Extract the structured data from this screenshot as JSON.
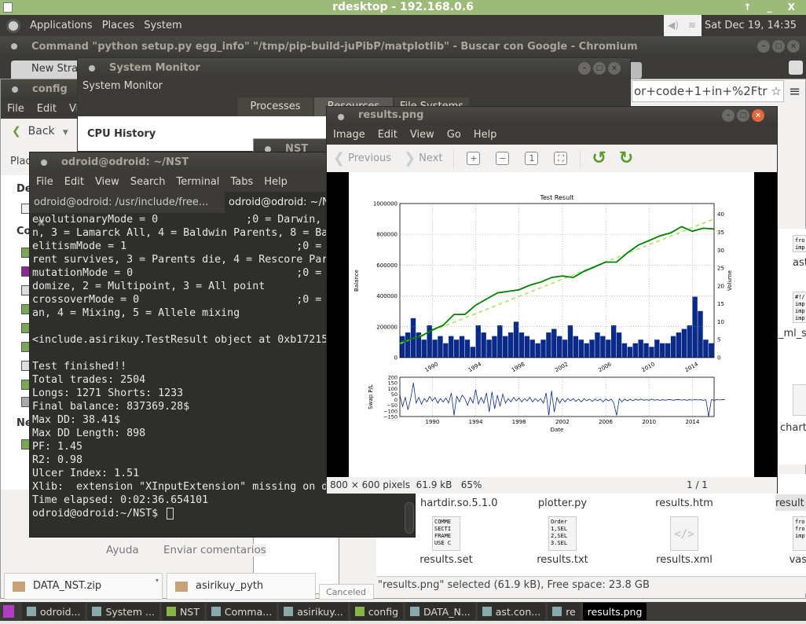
{
  "rdesktop": {
    "title": "rdesktop - 192.168.0.6",
    "controls": "↑ _ X"
  },
  "panel": {
    "menus": [
      "Applications",
      "Places",
      "System"
    ],
    "clock": "Sat Dec 19, 14:35",
    "tray_icons": [
      "volume-icon",
      "wifi-icon"
    ]
  },
  "chromium": {
    "title": "Command \"python setup.py egg_info\" \"/tmp/pip-build-juPibP/matplotlib\" - Buscar con Google - Chromium",
    "tab": "New Strat",
    "omnibox": "or+code+1+in+%2Ftr",
    "footer_links": [
      "Ayuda",
      "Enviar comentarios"
    ],
    "downloads": [
      {
        "name": "DATA_NST.zip"
      },
      {
        "name": "asirikuy_pyth"
      }
    ],
    "canceled": "Canceled"
  },
  "sysmon": {
    "title": "System Monitor",
    "header": "System Monitor",
    "tabs": [
      "Processes",
      "Resources",
      "File Systems"
    ],
    "section": "CPU History"
  },
  "config": {
    "title": "config",
    "menus": [
      "File",
      "Edit",
      "Vi"
    ],
    "back": "Back",
    "places": "Plac",
    "sidebar_headers": [
      "De",
      "Co",
      "Ne"
    ]
  },
  "nst": {
    "title": "NST"
  },
  "terminal": {
    "title": "odroid@odroid: ~/NST",
    "menus": [
      "File",
      "Edit",
      "View",
      "Search",
      "Terminal",
      "Tabs",
      "Help"
    ],
    "tabs": [
      "odroid@odroid: /usr/include/free...",
      "odroid@odroid: ~/NST"
    ],
    "lines": [
      "evolutionaryMode = 0              ;0 = Darwin, 1",
      "n, 3 = Lamarck All, 4 = Baldwin Parents, 8 = Ba",
      "elitismMode = 1                           ;0 = Ur",
      "rent survives, 3 = Parents die, 4 = Rescore Par",
      "mutationMode = 0                          ;0 = Si",
      "domize, 2 = Multipoint, 3 = All point",
      "crossoverMode = 0                         ;0 = Si",
      "an, 4 = Mixing, 5 = Allele mixing",
      "",
      "<include.asirikuy.TestResult object at 0xb17215",
      "",
      "Test finished!!",
      "Total trades: 2504",
      "Longs: 1271 Shorts: 1233",
      "Final balance: 837369.28$",
      "Max DD: 38.41$",
      "Max DD Length: 898",
      "PF: 1.45",
      "R2: 0.98",
      "Ulcer Index: 1.51",
      "Xlib:  extension \"XInputExtension\" missing on d",
      "Time elapsed: 0:02:36.654101",
      "odroid@odroid:~/NST$ "
    ]
  },
  "viewer": {
    "title": "results.png",
    "menus": [
      "Image",
      "Edit",
      "View",
      "Go",
      "Help"
    ],
    "toolbar": {
      "previous": "Previous",
      "next": "Next"
    },
    "status": {
      "dimensions": "800 × 600 pixels",
      "size": "61.9 kB",
      "zoom": "65%",
      "page": "1 / 1"
    }
  },
  "files": {
    "items": [
      {
        "name": "hartdir.so.5.1.0",
        "thumb": ""
      },
      {
        "name": "plotter.py",
        "thumb": ""
      },
      {
        "name": "results.htm",
        "thumb": ""
      },
      {
        "name": "result",
        "thumb": ""
      },
      {
        "name": "results.set",
        "thumb": "COMME\nSECTI\nFRAME\nUSE C"
      },
      {
        "name": "results.txt",
        "thumb": "Order\n1,SEL\n2,SEL\n3.SEL"
      },
      {
        "name": "results.xml",
        "thumb": "</>"
      },
      {
        "name": "vas",
        "thumb": "fro\nfro\nimp"
      }
    ],
    "right_items": [
      {
        "name": "ast",
        "thumb": "fro\nimp"
      },
      {
        "name": "_ml_st",
        "thumb": "#!/\nimp\nimp\nimp"
      },
      {
        "name": "chart",
        "thumb": ""
      }
    ],
    "status": "\"results.png\" selected (61.9 kB), Free space: 23.8 GB"
  },
  "taskbar": {
    "items": [
      "odroid...",
      "System ...",
      "NST",
      "Comma...",
      "asirikuy...",
      "config",
      "DATA_N...",
      "ast.con...",
      "re",
      "results.png"
    ]
  },
  "chart_data": [
    {
      "type": "line",
      "title": "Test Result",
      "xlabel": "",
      "ylabel": "Balance",
      "y2label": "Volume",
      "xlim": [
        1987,
        2016
      ],
      "ylim": [
        0,
        1000000
      ],
      "y2lim": [
        0,
        43
      ],
      "grid": true,
      "xticks": [
        "1990",
        "1994",
        "1998",
        "2002",
        "2006",
        "2010",
        "2014"
      ],
      "yticks": [
        "0",
        "200000",
        "400000",
        "600000",
        "800000",
        "1000000"
      ],
      "y2ticks": [
        "0",
        "5",
        "10",
        "15",
        "20",
        "25",
        "30",
        "35",
        "40"
      ],
      "balance": {
        "x": [
          1987,
          1988,
          1989,
          1990,
          1991,
          1992,
          1993,
          1994,
          1995,
          1996,
          1997,
          1998,
          1999,
          2000,
          2001,
          2002,
          2003,
          2004,
          2005,
          2006,
          2007,
          2008,
          2009,
          2010,
          2011,
          2012,
          2013,
          2014,
          2015,
          2016
        ],
        "y": [
          100000,
          120000,
          140000,
          180000,
          210000,
          280000,
          280000,
          340000,
          380000,
          420000,
          430000,
          440000,
          470000,
          490000,
          520000,
          530000,
          520000,
          560000,
          590000,
          620000,
          620000,
          680000,
          730000,
          760000,
          790000,
          810000,
          850000,
          820000,
          840000,
          835000
        ],
        "color": "#008000"
      },
      "trend": {
        "x": [
          1987,
          2016
        ],
        "y": [
          90000,
          900000
        ],
        "color": "#a6e35a",
        "style": "dashed"
      },
      "volume": {
        "x_start": 1987,
        "step": 0.5,
        "values": [
          6,
          7,
          11,
          7,
          5,
          9,
          5,
          6,
          4,
          6,
          5,
          6,
          5,
          3,
          9,
          7,
          5,
          6,
          9,
          6,
          7,
          10,
          7,
          6,
          5,
          4,
          5,
          7,
          8,
          6,
          5,
          9,
          6,
          5,
          4,
          5,
          7,
          6,
          5,
          9,
          7,
          4,
          3,
          4,
          5,
          4,
          3,
          5,
          4,
          4,
          6,
          7,
          8,
          9,
          17,
          13,
          5,
          4
        ],
        "color": "#0a2a8a"
      }
    },
    {
      "type": "line",
      "xlabel": "Date",
      "ylabel": "Swap P/L",
      "xlim": [
        1987,
        2016
      ],
      "ylim": [
        -150,
        200
      ],
      "xticks": [
        "1990",
        "1994",
        "1998",
        "2002",
        "2006",
        "2010",
        "2014"
      ],
      "yticks": [
        "200",
        "150",
        "100",
        "50",
        "0",
        "−50",
        "−100",
        "−150"
      ],
      "swap": {
        "x_start": 1987,
        "step": 0.25,
        "values": [
          40,
          -60,
          20,
          -90,
          10,
          150,
          -30,
          20,
          -40,
          10,
          -20,
          30,
          -10,
          20,
          -30,
          10,
          -20,
          15,
          -30,
          60,
          -140,
          30,
          -20,
          40,
          10,
          -50,
          20,
          -30,
          90,
          -40,
          20,
          -30,
          60,
          -110,
          70,
          -80,
          40,
          -60,
          50,
          -30,
          10,
          -20,
          20,
          -10,
          15,
          -20,
          10,
          -10,
          20,
          -20,
          10,
          -15,
          10,
          -30,
          60,
          -140,
          80,
          -110,
          20,
          -30,
          10,
          -20,
          10,
          -10,
          10,
          -15,
          5,
          -20,
          10,
          -10,
          5,
          -15,
          5,
          -10,
          5,
          -20,
          5,
          -10,
          5,
          -30,
          -140,
          10,
          -20,
          5,
          -10,
          5,
          -10,
          5,
          -5,
          5,
          -5,
          0,
          -5,
          5,
          -5,
          0,
          -5,
          0,
          -5,
          0,
          0,
          -5,
          0,
          0,
          -3,
          0,
          -5,
          0,
          -3,
          0,
          -2,
          0,
          -5,
          0,
          -150,
          0,
          -5,
          0,
          -2,
          0,
          0
        ],
        "color": "#0a2a8a"
      }
    }
  ]
}
